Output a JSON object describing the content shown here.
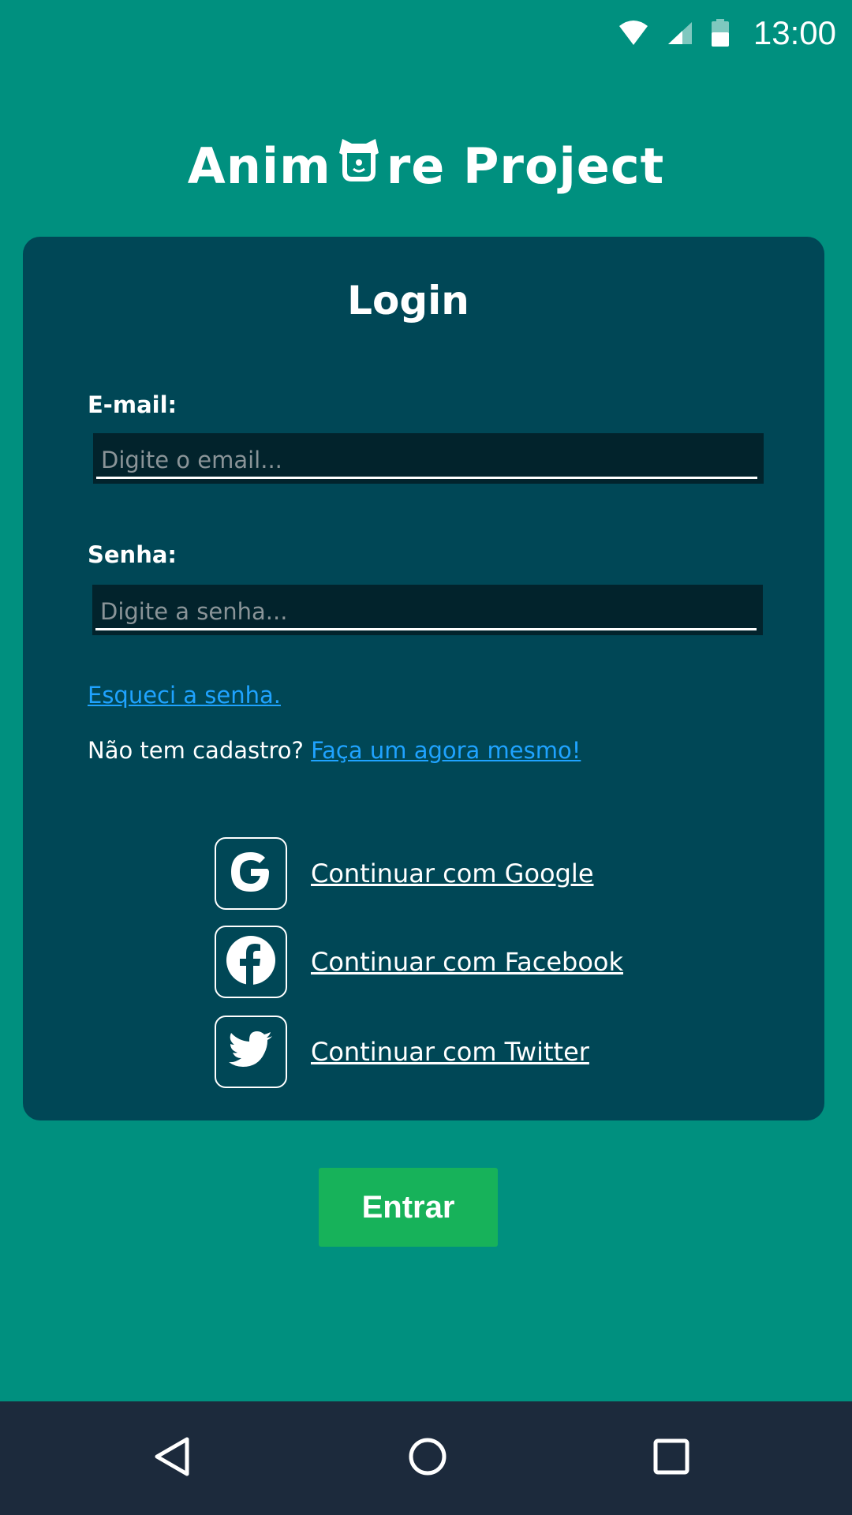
{
  "status_bar": {
    "time": "13:00",
    "icons": [
      "wifi-icon",
      "cell-signal-icon",
      "battery-icon"
    ]
  },
  "app": {
    "title_prefix": "Anim",
    "title_suffix": "re Project"
  },
  "login": {
    "title": "Login",
    "email_label": "E-mail:",
    "email_placeholder": "Digite o email...",
    "email_value": "",
    "password_label": "Senha:",
    "password_placeholder": "Digite a senha...",
    "password_value": "",
    "forgot_password": "Esqueci a senha.",
    "no_account_text": "Não tem cadastro?",
    "signup_link": "Faça um agora mesmo!"
  },
  "social": {
    "google": "Continuar com Google",
    "facebook": "Continuar com Facebook",
    "twitter": "Continuar com Twitter"
  },
  "submit_label": "Entrar",
  "nav": {
    "icons": [
      "back-icon",
      "home-icon",
      "recents-icon"
    ]
  },
  "colors": {
    "background": "#00907F",
    "card": "#004756",
    "input_bg": "#02232C",
    "link": "#1FA3FF",
    "submit": "#17B25A",
    "nav_bar": "#1C2A3C"
  }
}
